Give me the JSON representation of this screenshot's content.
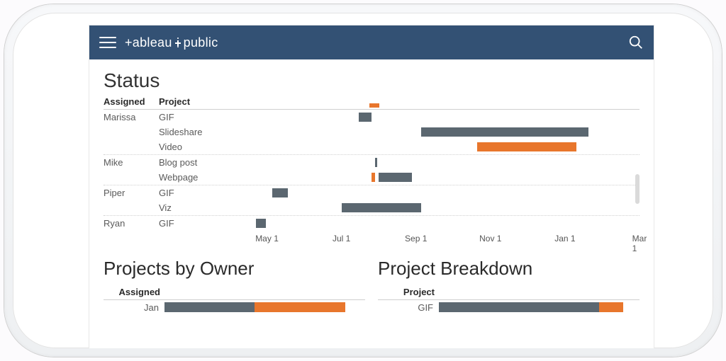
{
  "brand": {
    "part1": "+ableau",
    "part2": "public"
  },
  "titles": {
    "status": "Status",
    "projects_by_owner": "Projects by Owner",
    "project_breakdown": "Project Breakdown"
  },
  "gantt": {
    "head_assigned": "Assigned",
    "head_project": "Project",
    "axis": [
      "May 1",
      "Jul 1",
      "Sep 1",
      "Nov 1",
      "Jan 1",
      "Mar 1"
    ]
  },
  "mini_head_assigned": "Assigned",
  "mini_head_project": "Project",
  "owners_label": {
    "jan": "Jan"
  },
  "projects_label": {
    "gif": "GIF"
  },
  "colors": {
    "grey": "#5b6770",
    "orange": "#e8762c",
    "navbar": "#335174"
  },
  "chart_data": [
    {
      "type": "bar",
      "title": "Status",
      "orientation": "horizontal-gantt",
      "x_axis": {
        "type": "date",
        "range": [
          "Apr 1",
          "Mar 1"
        ],
        "ticks": [
          "May 1",
          "Jul 1",
          "Sep 1",
          "Nov 1",
          "Jan 1",
          "Mar 1"
        ]
      },
      "groups": [
        {
          "owner": "Marissa",
          "rows": [
            {
              "project": "GIF",
              "bars": [
                {
                  "start": "Jul 15",
                  "end": "Jul 25",
                  "color": "grey"
                }
              ]
            },
            {
              "project": "Slideshare",
              "bars": [
                {
                  "start": "Sep 5",
                  "end": "Jan 20",
                  "color": "grey"
                }
              ]
            },
            {
              "project": "Video",
              "bars": [
                {
                  "start": "Oct 20",
                  "end": "Jan 10",
                  "color": "orange"
                }
              ]
            }
          ]
        },
        {
          "owner": "Mike",
          "rows": [
            {
              "project": "Blog post",
              "bars": [
                {
                  "start": "Jul 28",
                  "end": "Jul 30",
                  "color": "grey"
                }
              ]
            },
            {
              "project": "Webpage",
              "bars": [
                {
                  "start": "Aug 1",
                  "end": "Aug 28",
                  "color": "grey"
                },
                {
                  "start": "Jul 25",
                  "end": "Jul 28",
                  "color": "orange"
                }
              ]
            }
          ]
        },
        {
          "owner": "Piper",
          "rows": [
            {
              "project": "GIF",
              "bars": [
                {
                  "start": "May 5",
                  "end": "May 18",
                  "color": "grey"
                }
              ]
            },
            {
              "project": "Viz",
              "bars": [
                {
                  "start": "Jul 1",
                  "end": "Sep 5",
                  "color": "grey"
                }
              ]
            }
          ]
        },
        {
          "owner": "Ryan",
          "rows": [
            {
              "project": "GIF",
              "bars": [
                {
                  "start": "Apr 22",
                  "end": "Apr 30",
                  "color": "grey"
                }
              ]
            }
          ]
        }
      ],
      "top_marker": {
        "start": "Jul 22",
        "end": "Jul 30",
        "color": "orange"
      }
    },
    {
      "type": "bar",
      "title": "Projects by Owner",
      "orientation": "horizontal-stacked",
      "xlim": [
        0,
        100
      ],
      "series_colors": {
        "a": "grey",
        "b": "orange"
      },
      "rows": [
        {
          "label": "Jan",
          "segments": [
            {
              "color": "grey",
              "value": 45
            },
            {
              "color": "orange",
              "value": 45
            }
          ]
        }
      ]
    },
    {
      "type": "bar",
      "title": "Project Breakdown",
      "orientation": "horizontal-stacked",
      "xlim": [
        0,
        100
      ],
      "series_colors": {
        "a": "grey",
        "b": "orange"
      },
      "rows": [
        {
          "label": "GIF",
          "segments": [
            {
              "color": "grey",
              "value": 80
            },
            {
              "color": "orange",
              "value": 12
            }
          ]
        }
      ]
    }
  ]
}
